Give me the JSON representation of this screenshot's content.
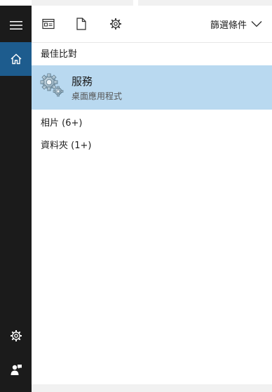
{
  "toolbar": {
    "filter_label": "篩選條件"
  },
  "best_match": {
    "section_title": "最佳比對",
    "title": "服務",
    "subtitle": "桌面應用程式"
  },
  "categories": [
    {
      "label": "相片 (6+)"
    },
    {
      "label": "資料夾 (1+)"
    }
  ],
  "icons": {
    "menu": "hamburger-menu-icon",
    "home": "home-icon",
    "settings": "gear-icon",
    "feedback": "feedback-icon",
    "apps": "apps-filter-icon",
    "documents": "document-icon",
    "web_settings": "gear-icon",
    "filter_dropdown": "chevron-down-icon",
    "result": "services-gear-icon"
  },
  "colors": {
    "rail": "#1b1b1b",
    "home_active": "#1d5c8e",
    "selection": "#b9d9f0"
  }
}
